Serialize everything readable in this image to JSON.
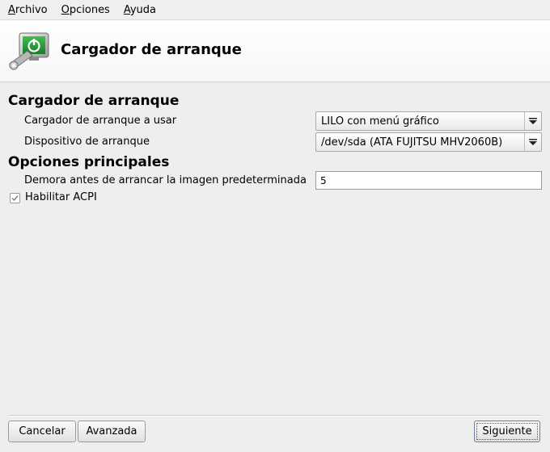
{
  "menubar": {
    "items": [
      {
        "mnemonic": "A",
        "rest": "rchivo"
      },
      {
        "mnemonic": "O",
        "rest": "pciones"
      },
      {
        "mnemonic": "A",
        "rest": "yuda"
      }
    ]
  },
  "header": {
    "title": "Cargador de arranque",
    "icon": "bootloader-power-icon"
  },
  "sections": {
    "bootloader_title": "Cargador de arranque",
    "main_options_title": "Opciones principales"
  },
  "fields": {
    "bootloader_label": "Cargador de arranque a usar",
    "bootloader_value": "LILO con menú gráfico",
    "boot_device_label": "Dispositivo de arranque",
    "boot_device_value": "/dev/sda (ATA FUJITSU MHV2060B)",
    "delay_label": "Demora antes de arrancar la imagen predeterminada",
    "delay_value": "5",
    "acpi_label": "Habilitar ACPI",
    "acpi_checked": true
  },
  "buttons": {
    "cancel": "Cancelar",
    "advanced": "Avanzada",
    "next": "Siguiente"
  }
}
